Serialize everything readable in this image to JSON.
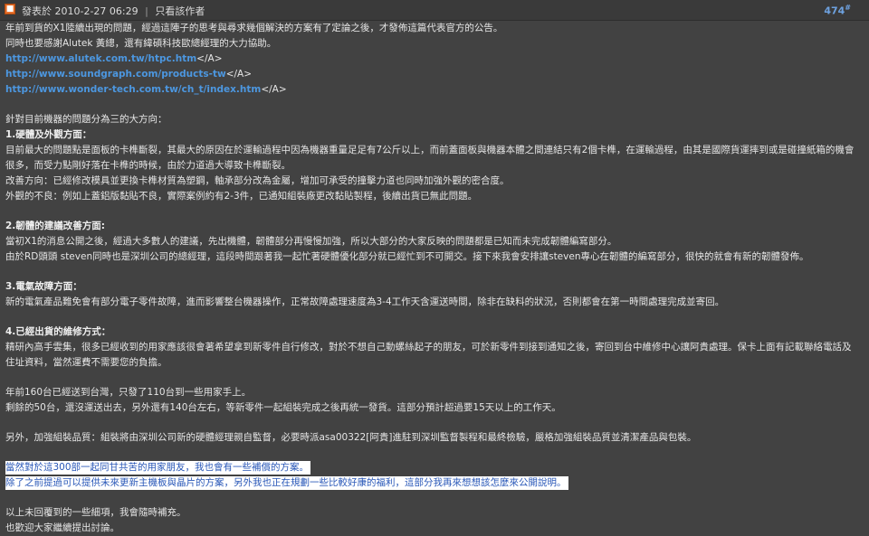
{
  "header": {
    "icon": "post-icon",
    "posted": "發表於 2010-2-27 06:29",
    "separator": "|",
    "only_author": "只看該作者",
    "floor": "474",
    "floor_mark": "#"
  },
  "intro": [
    "年前到貨的X1陸續出現的問題，經過這陣子的思考與尋求幾個解決的方案有了定論之後，才發佈這篇代表官方的公告。",
    "同時也要感謝Alutek 黃總，還有緯碩科技歐總經理的大力協助。"
  ],
  "links": [
    {
      "url": "http://www.alutek.com.tw/htpc.htm",
      "tail": "</A>"
    },
    {
      "url": "http://www.soundgraph.com/products-tw",
      "tail": "</A>"
    },
    {
      "url": "http://www.wonder-tech.com.tw/ch_t/index.htm",
      "tail": "</A>"
    }
  ],
  "directions": "針對目前機器的問題分為三的大方向：",
  "section1": {
    "title": "1.硬體及外觀方面：",
    "lines": [
      "目前最大的問題點是面板的卡榫斷裂，其最大的原因在於運輸過程中因為機器重量足足有7公斤以上，而前蓋面板與機器本體之間連結只有2個卡榫，在運輸過程，由其是國際貨運摔到或是碰撞紙箱的機會",
      "很多，而受力點剛好落在卡榫的時候，由於力道過大導致卡榫斷裂。",
      "改善方向：已經修改模具並更換卡榫材質為塑鋼，軸承部分改為金屬，增加可承受的撞擊力道也同時加強外觀的密合度。",
      "外觀的不良：例如上蓋鋁版黏貼不良，實際案例約有2-3件，已通知組裝廠更改黏貼製程，後續出貨已無此問題。"
    ]
  },
  "section2": {
    "title": "2.韌體的建議改善方面:",
    "lines": [
      "當初X1的消息公開之後，經過大多數人的建議，先出機體，韌體部分再慢慢加強，所以大部分的大家反映的問題都是已知而未完成韌體編寫部分。",
      "由於RD頭頭 steven同時也是深圳公司的總經理，這段時間跟著我一起忙著硬體優化部分就已經忙到不可開交。接下來我會安排讓steven專心在韌體的編寫部分，很快的就會有新的韌體發佈。"
    ]
  },
  "section3": {
    "title": "3.電氣故障方面：",
    "lines": [
      "新的電氣產品難免會有部分電子零件故障，進而影響整台機器操作，正常故障處理速度為3-4工作天含運送時間，除非在缺料的狀況，否則都會在第一時間處理完成並寄回。"
    ]
  },
  "section4": {
    "title": "4.已經出貨的維修方式：",
    "lines": [
      "精研內高手雲集，很多已經收到的用家應該很會著希望拿到新零件自行修改，對於不想自己動螺絲起子的朋友，可於新零件到接到通知之後，寄回到台中維修中心讓阿貴處理。保卡上面有記載聯絡電話及",
      "住址資料，當然運費不需要您的負擔。"
    ]
  },
  "shipping": [
    "年前160台已經送到台灣，只發了110台到一些用家手上。",
    "剩餘的50台，還沒運送出去，另外還有140台左右，等新零件一起組裝完成之後再統一發貨。這部分預計超過要15天以上的工作天。"
  ],
  "quality": "另外，加強組裝品質：組裝將由深圳公司新的硬體經理親自監督，必要時派asa00322[阿貴]進駐到深圳監督製程和最終檢驗，嚴格加強組裝品質並清潔產品與包裝。",
  "highlights": [
    "當然對於這300部一起同甘共苦的用家朋友，我也會有一些補償的方案。",
    "除了之前提過可以提供未來更新主機板與晶片的方案，另外我也正在規劃一些比較好康的福利，這部分我再來想想該怎麼來公開說明。"
  ],
  "closing": [
    "以上未回覆到的一些細項，我會隨時補充。",
    "也歡迎大家繼續提出討論。"
  ]
}
